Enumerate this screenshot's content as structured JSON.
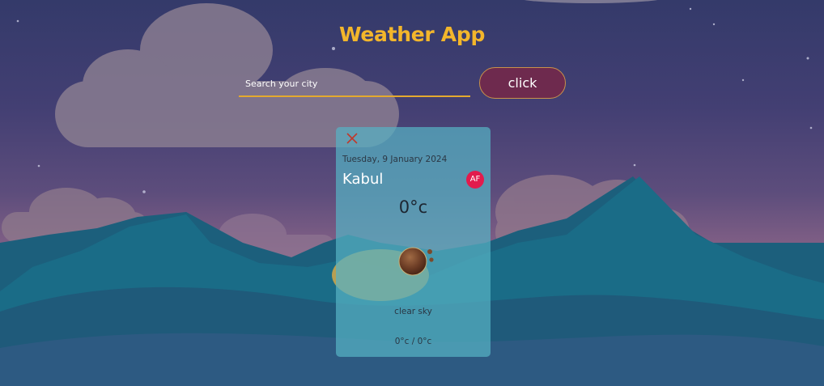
{
  "app": {
    "title": "Weather App"
  },
  "search": {
    "placeholder": "Search your city",
    "value": "",
    "button_label": "click"
  },
  "weather_card": {
    "date": "Tuesday, 9 January 2024",
    "city": "Kabul",
    "country_code": "AF",
    "temperature": "0°c",
    "condition_icon": "clear-sky-icon",
    "description": "clear sky",
    "min_max": "0°c / 0°c",
    "close_icon": "close-icon"
  },
  "colors": {
    "title": "#f3b62b",
    "button_bg": "#6e2a4e",
    "input_underline": "#e4a92e",
    "country_badge": "#e21b4d",
    "card_bg": "#56b2c4",
    "close_icon": "#c0392b"
  }
}
